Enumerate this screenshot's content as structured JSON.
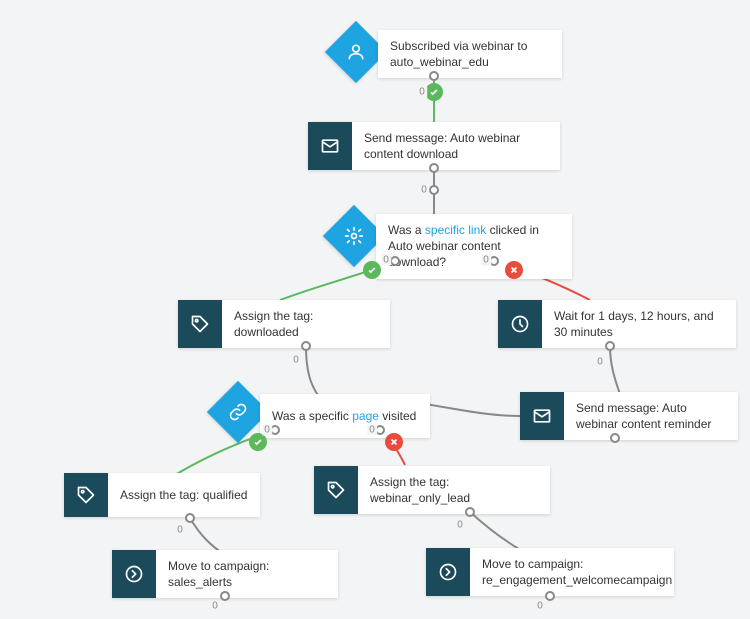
{
  "colors": {
    "accent": "#1ea4e0",
    "node_icon_bg": "#1b4a5a",
    "yes": "#5cb85c",
    "no": "#e74c3c",
    "edge": "#888"
  },
  "counts": {
    "n1_out": "0",
    "n2_out": "0",
    "n3_yes": "0",
    "n3_no": "0",
    "n4_out": "0",
    "n5_out": "0",
    "n6_yes": "0",
    "n6_no": "0",
    "n7_out": "0",
    "n8_out": "0",
    "n9_out": "0",
    "n10_out": "0",
    "n11_out": "0"
  },
  "nodes": {
    "n1": {
      "type": "condition",
      "icon": "user-icon",
      "text_parts": [
        "Subscribed via webinar to ",
        "auto_webinar_edu"
      ]
    },
    "n2": {
      "type": "action",
      "icon": "mail-icon",
      "text": "Send message: Auto webinar content download"
    },
    "n3": {
      "type": "condition",
      "icon": "gear-icon",
      "text_parts": [
        "Was a ",
        "specific link",
        " clicked in Auto webinar content download?"
      ],
      "link_index": 1
    },
    "n4": {
      "type": "action",
      "icon": "tag-icon",
      "text": "Assign the tag: downloaded"
    },
    "n5": {
      "type": "action",
      "icon": "clock-icon",
      "text": "Wait for 1 days, 12 hours, and 30 minutes"
    },
    "n6": {
      "type": "condition",
      "icon": "link-icon",
      "text_parts": [
        "Was a specific ",
        "page",
        " visited"
      ],
      "link_index": 1
    },
    "n7": {
      "type": "action",
      "icon": "mail-icon",
      "text": "Send message: Auto webinar content reminder"
    },
    "n8": {
      "type": "action",
      "icon": "tag-icon",
      "text": "Assign the tag: qualified"
    },
    "n9": {
      "type": "action",
      "icon": "tag-icon",
      "text": "Assign the tag: webinar_only_lead"
    },
    "n10": {
      "type": "action",
      "icon": "arrow-right-circle-icon",
      "text": "Move to campaign: sales_alerts"
    },
    "n11": {
      "type": "action",
      "icon": "arrow-right-circle-icon",
      "text": "Move to campaign: re_engagement_welcomecampaign"
    }
  }
}
